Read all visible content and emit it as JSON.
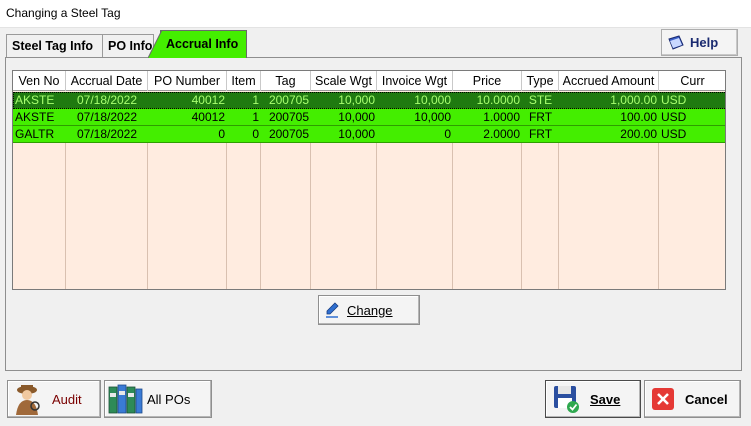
{
  "window": {
    "title": "Changing a Steel Tag"
  },
  "tabs": [
    {
      "label": "Steel Tag Info"
    },
    {
      "label": "PO Info"
    },
    {
      "label": "Accrual Info"
    }
  ],
  "help_label": "Help",
  "table": {
    "columns": [
      "Ven No",
      "Accrual Date",
      "PO Number",
      "Item",
      "Tag",
      "Scale Wgt",
      "Invoice Wgt",
      "Price",
      "Type",
      "Accrued Amount",
      "Curr"
    ],
    "rows": [
      [
        "AKSTE",
        "07/18/2022",
        "40012",
        "1",
        "200705",
        "10,000",
        "10,000",
        "10.0000",
        "STE",
        "1,000.00",
        "USD"
      ],
      [
        "AKSTE",
        "07/18/2022",
        "40012",
        "1",
        "200705",
        "10,000",
        "10,000",
        "1.0000",
        "FRT",
        "100.00",
        "USD"
      ],
      [
        "GALTR",
        "07/18/2022",
        "0",
        "0",
        "200705",
        "10,000",
        "0",
        "2.0000",
        "FRT",
        "200.00",
        "USD"
      ]
    ]
  },
  "buttons": {
    "change": "Change",
    "audit": "Audit",
    "all_pos": "All POs",
    "save": "Save",
    "cancel": "Cancel"
  },
  "colors": {
    "row_green": "#44ee00",
    "selected_row": "#1f7a10",
    "grid_background": "#ffece0",
    "cancel_red": "#e53935"
  }
}
